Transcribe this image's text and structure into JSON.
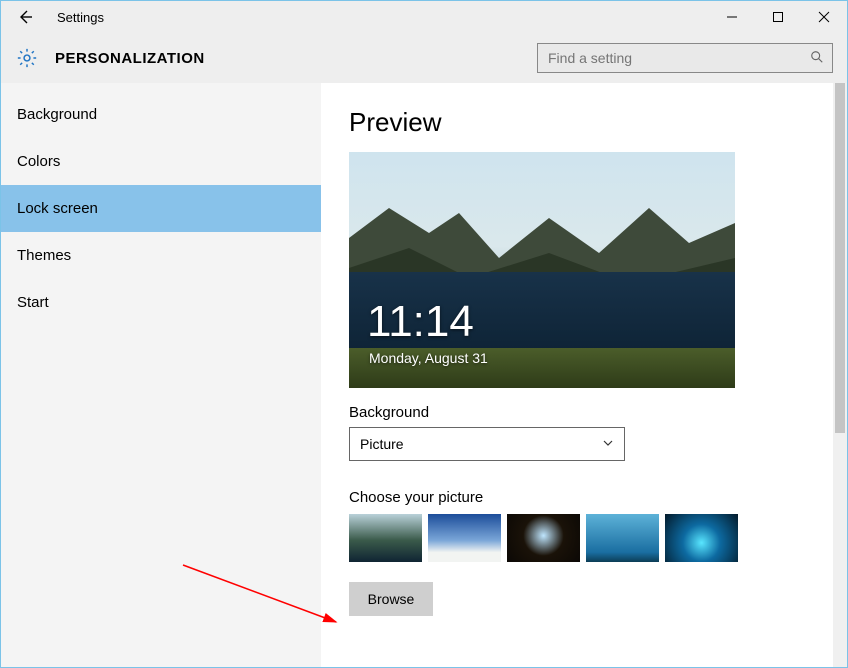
{
  "window": {
    "title": "Settings"
  },
  "header": {
    "category": "PERSONALIZATION",
    "search_placeholder": "Find a setting"
  },
  "sidebar": {
    "items": [
      {
        "label": "Background",
        "selected": false
      },
      {
        "label": "Colors",
        "selected": false
      },
      {
        "label": "Lock screen",
        "selected": true
      },
      {
        "label": "Themes",
        "selected": false
      },
      {
        "label": "Start",
        "selected": false
      }
    ]
  },
  "content": {
    "preview_heading": "Preview",
    "time": "11:14",
    "date": "Monday, August 31",
    "background_label": "Background",
    "background_value": "Picture",
    "choose_label": "Choose your picture",
    "browse_label": "Browse",
    "thumbnails": [
      {
        "name": "mountain-lake"
      },
      {
        "name": "blue-sky-dunes"
      },
      {
        "name": "cave-beach"
      },
      {
        "name": "sea-diver"
      },
      {
        "name": "ice-cave"
      }
    ]
  }
}
